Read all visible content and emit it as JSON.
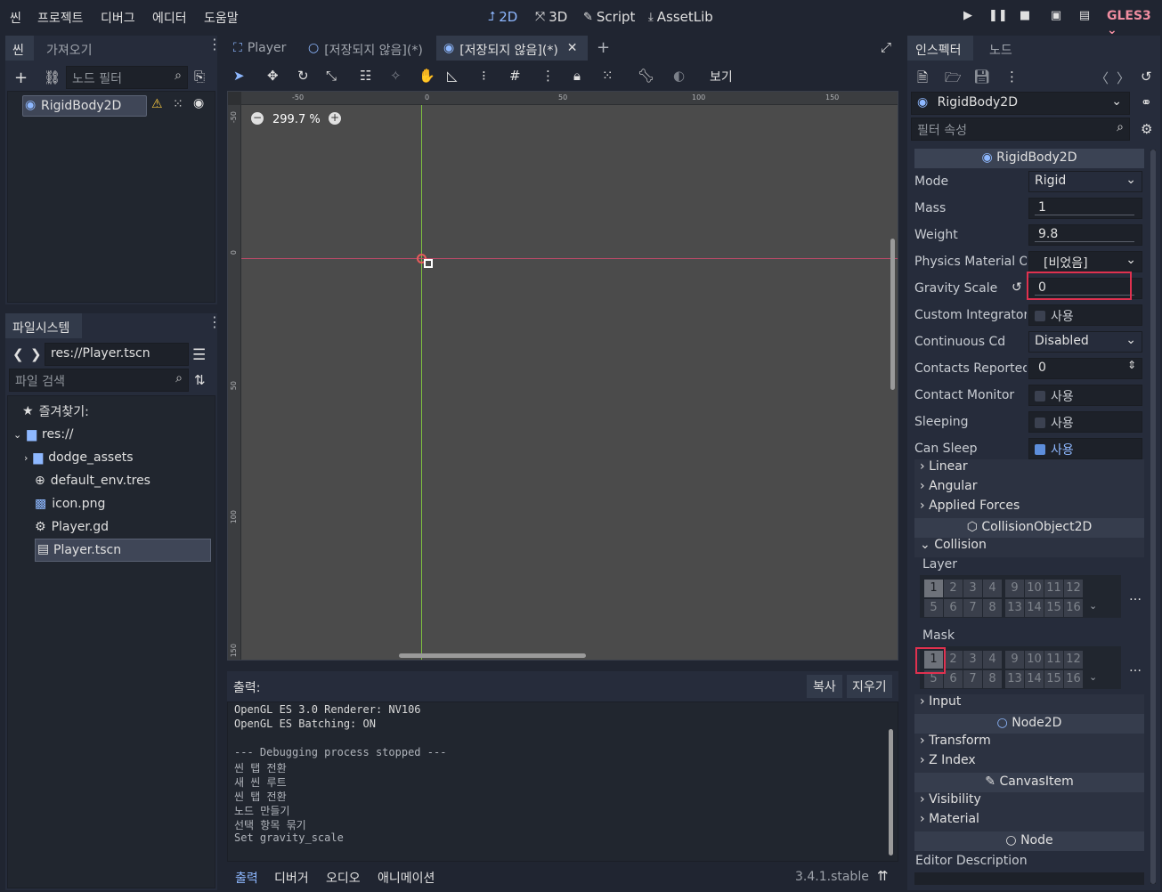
{
  "menu": [
    "씬",
    "프로젝트",
    "디버그",
    "에디터",
    "도움말"
  ],
  "workspaces": [
    "2D",
    "3D",
    "Script",
    "AssetLib"
  ],
  "renderer": "GLES3",
  "colors": {
    "accent": "#8eb8ff",
    "renderer": "#f08da0",
    "highlight_box": "#e0314f"
  },
  "scene_panel": {
    "tabs": [
      "씬",
      "가져오기"
    ],
    "filter_placeholder": "노드 필터",
    "root_node": "RigidBody2D"
  },
  "filesystem": {
    "title": "파일시스템",
    "path": "res://Player.tscn",
    "search_placeholder": "파일 검색",
    "favorites": "즐겨찾기:",
    "root": "res://",
    "items": [
      "dodge_assets",
      "default_env.tres",
      "icon.png",
      "Player.gd",
      "Player.tscn"
    ]
  },
  "editor_tabs": [
    "Player",
    "[저장되지 않음](*)",
    "[저장되지 않음](*)"
  ],
  "toolbar": {
    "view_label": "보기"
  },
  "viewport": {
    "zoom": "299.7 %",
    "ruler_h": [
      "-50",
      "0",
      "50",
      "100",
      "150"
    ],
    "ruler_v": [
      "-50",
      "0",
      "50",
      "100",
      "150"
    ]
  },
  "output": {
    "title": "출력:",
    "copy": "복사",
    "clear": "지우기",
    "lines": [
      "OpenGL ES 3.0 Renderer: NV106",
      "OpenGL ES Batching: ON",
      "",
      "--- Debugging process stopped ---",
      "씬 탭 전환",
      "새 씬 루트",
      "씬 탭 전환",
      "노드 만들기",
      "선택 항목 묶기",
      "Set gravity_scale"
    ],
    "bottom_tabs": [
      "출력",
      "디버거",
      "오디오",
      "애니메이션"
    ],
    "version": "3.4.1.stable"
  },
  "inspector": {
    "tabs": [
      "인스펙터",
      "노드"
    ],
    "object": "RigidBody2D",
    "filter_placeholder": "필터 속성",
    "header": "RigidBody2D",
    "props": [
      {
        "label": "Mode",
        "value": "Rigid"
      },
      {
        "label": "Mass",
        "value": "1"
      },
      {
        "label": "Weight",
        "value": "9.8"
      },
      {
        "label": "Physics Material O",
        "value": "[비었음]"
      },
      {
        "label": "Gravity Scale",
        "value": "0"
      },
      {
        "label": "Custom Integrator",
        "value": "사용"
      },
      {
        "label": "Continuous Cd",
        "value": "Disabled"
      },
      {
        "label": "Contacts Reported",
        "value": "0"
      },
      {
        "label": "Contact Monitor",
        "value": "사용"
      },
      {
        "label": "Sleeping",
        "value": "사용"
      },
      {
        "label": "Can Sleep",
        "value": "사용"
      }
    ],
    "sections_rigid": [
      "Linear",
      "Angular",
      "Applied Forces"
    ],
    "collision_cat": "CollisionObject2D",
    "collision": "Collision",
    "layer": "Layer",
    "mask": "Mask",
    "bits_row1": [
      "1",
      "2",
      "3",
      "4",
      "9",
      "10",
      "11",
      "12"
    ],
    "bits_row2": [
      "5",
      "6",
      "7",
      "8",
      "13",
      "14",
      "15",
      "16"
    ],
    "input": "Input",
    "node2d_cat": "Node2D",
    "node2d_sections": [
      "Transform",
      "Z Index"
    ],
    "canvas_cat": "CanvasItem",
    "canvas_sections": [
      "Visibility",
      "Material"
    ],
    "node_cat": "Node",
    "editor_description": "Editor Description"
  }
}
